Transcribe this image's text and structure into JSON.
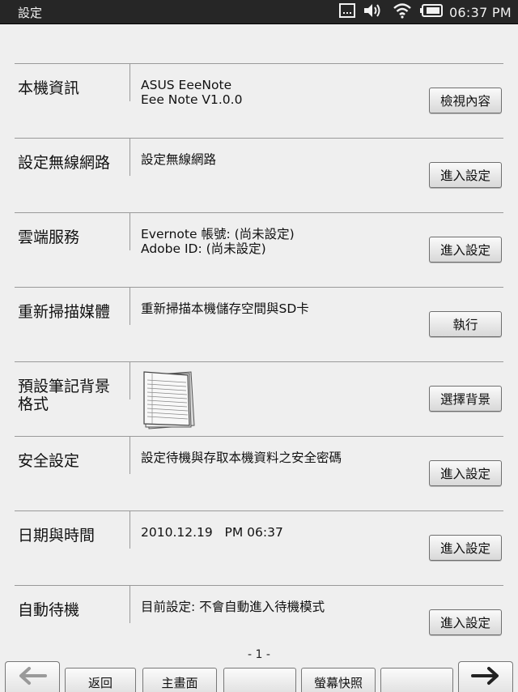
{
  "statusbar": {
    "title": "設定",
    "time": "06:37 PM",
    "icons": [
      "keyboard-icon",
      "volume-icon",
      "wifi-icon",
      "battery-icon"
    ]
  },
  "rows": [
    {
      "label": "本機資訊",
      "desc_lines": [
        "ASUS EeeNote",
        "Eee Note V1.0.0"
      ],
      "button": "檢視內容"
    },
    {
      "label": "設定無線網路",
      "desc_lines": [
        "設定無線網路"
      ],
      "button": "進入設定"
    },
    {
      "label": "雲端服務",
      "desc_lines": [
        "Evernote 帳號: (尚未設定)",
        "Adobe ID: (尚未設定)"
      ],
      "button": "進入設定"
    },
    {
      "label": "重新掃描媒體",
      "desc_lines": [
        "重新掃描本機儲存空間與SD卡"
      ],
      "button": "執行"
    },
    {
      "label_lines": [
        "預設筆記背景",
        "格式"
      ],
      "button": "選擇背景"
    },
    {
      "label": "安全設定",
      "desc_lines": [
        "設定待機與存取本機資料之安全密碼"
      ],
      "button": "進入設定"
    },
    {
      "label": "日期與時間",
      "desc_lines": [
        "2010.12.19   PM 06:37"
      ],
      "button": "進入設定"
    },
    {
      "label": "自動待機",
      "desc_lines": [
        "目前設定: 不會自動進入待機模式"
      ],
      "button": "進入設定"
    }
  ],
  "pager": {
    "text": "- 1 -"
  },
  "bottombar": {
    "back_label": "返回",
    "home_label": "主畫面",
    "empty1_label": "",
    "screenshot_label": "螢幕快照",
    "empty2_label": ""
  },
  "colors": {
    "statusbar_bg": "#262626",
    "page_bg": "#efefef",
    "divider": "#999999"
  }
}
